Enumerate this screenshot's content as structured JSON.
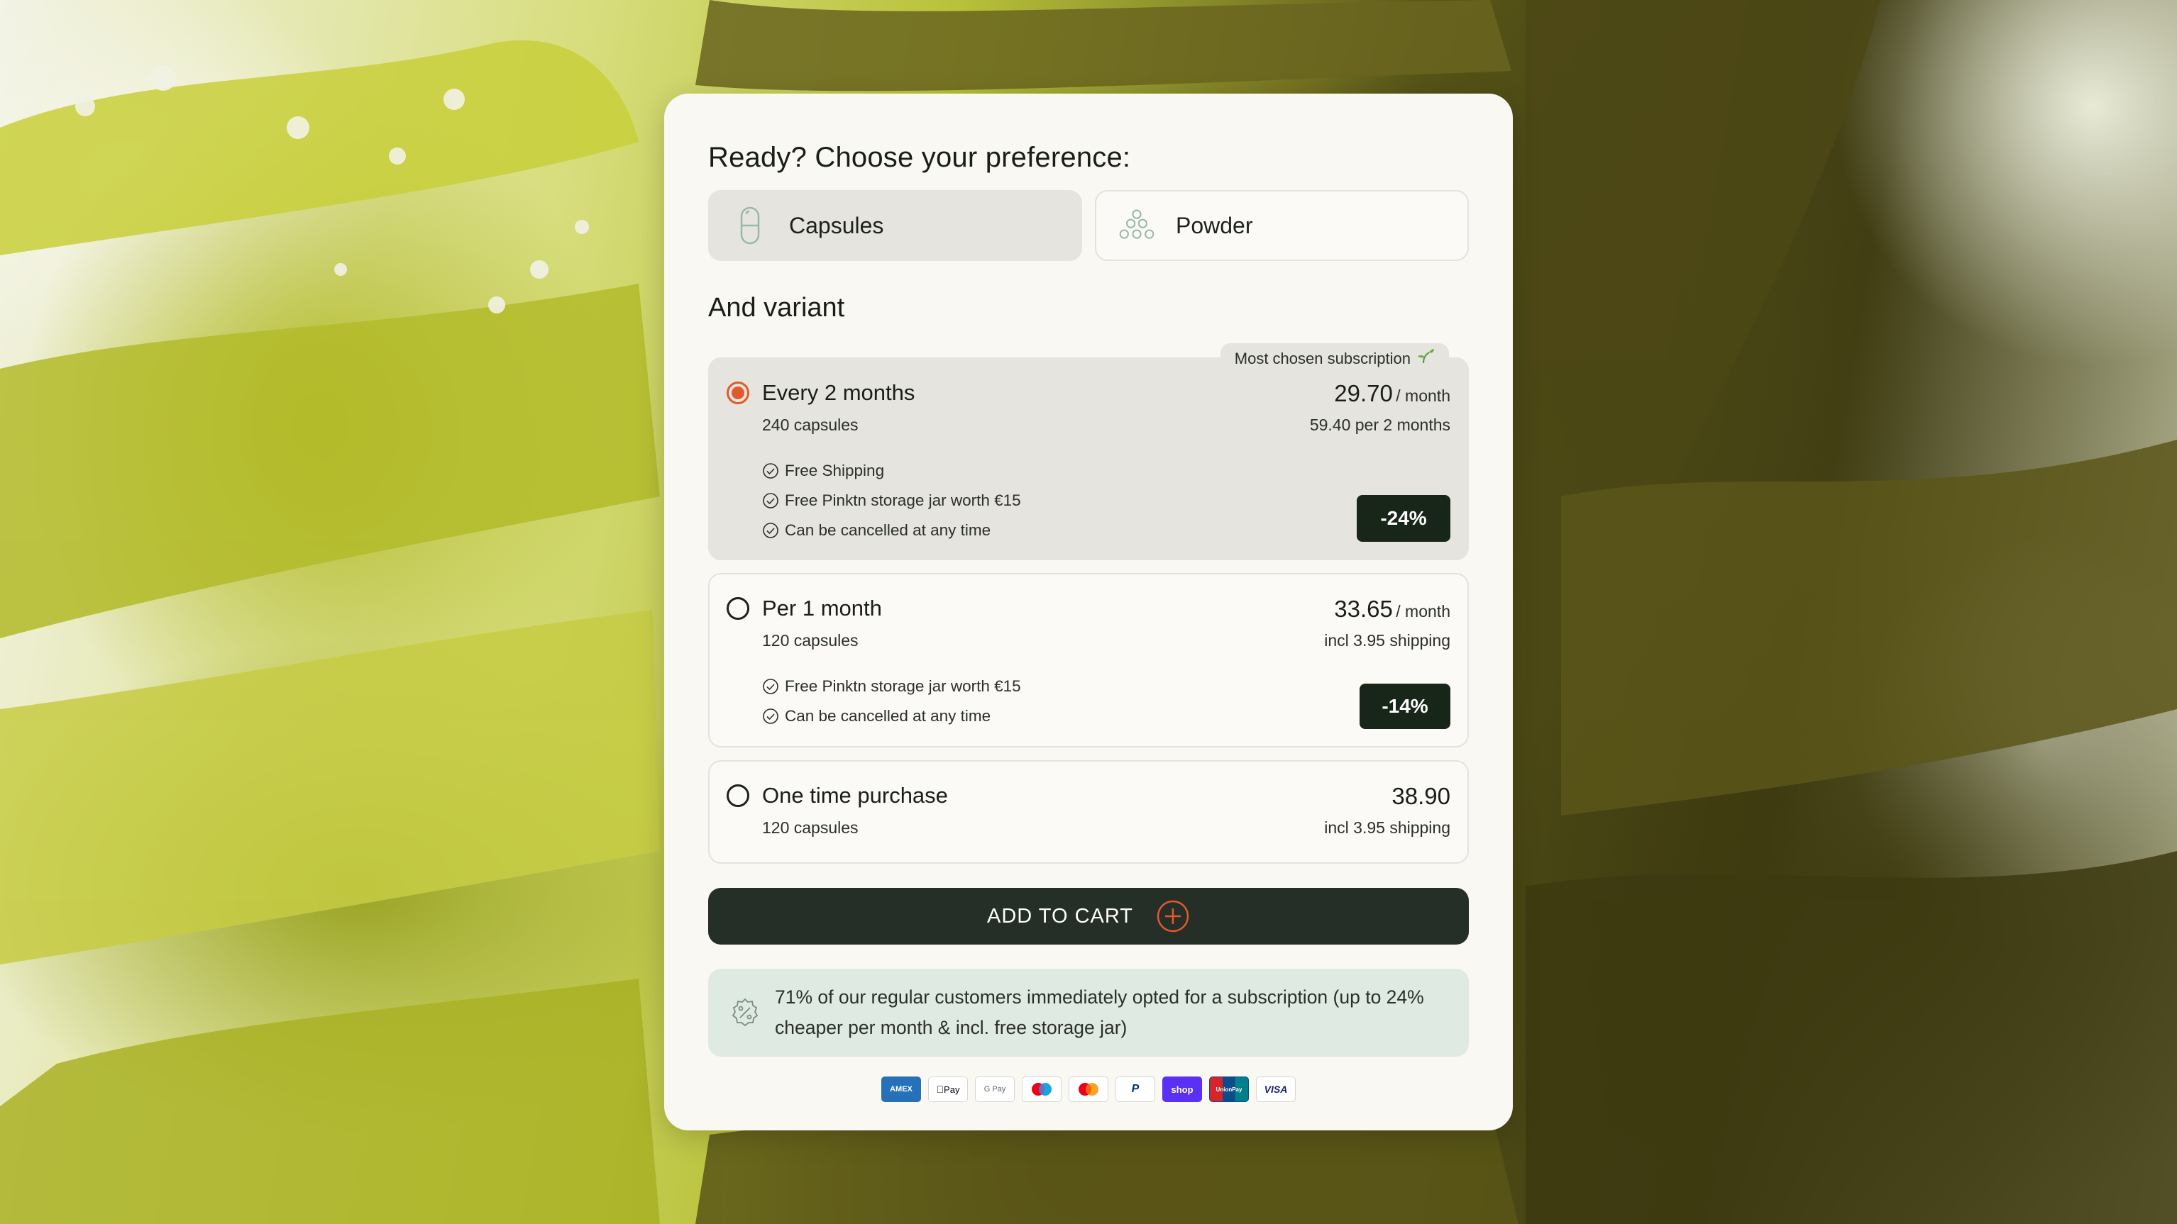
{
  "preference": {
    "title": "Ready? Choose your preference:",
    "options": [
      {
        "label": "Capsules",
        "icon": "capsule-icon",
        "selected": true
      },
      {
        "label": "Powder",
        "icon": "powder-icon",
        "selected": false
      }
    ]
  },
  "variant": {
    "title": "And variant",
    "most_chosen_tag": "Most chosen subscription",
    "options": [
      {
        "name": "Every 2 months",
        "quantity": "240 capsules",
        "price": "29.70",
        "price_unit": "/ month",
        "price_sub": "59.40 per 2 months",
        "features": [
          "Free Shipping",
          "Free Pinktn storage jar worth €15",
          "Can be cancelled at any time"
        ],
        "discount": "-24%",
        "selected": true
      },
      {
        "name": "Per 1 month",
        "quantity": "120 capsules",
        "price": "33.65",
        "price_unit": "/ month",
        "price_sub": "incl 3.95 shipping",
        "features": [
          "Free Pinktn storage jar worth €15",
          "Can be cancelled at any time"
        ],
        "discount": "-14%",
        "selected": false
      },
      {
        "name": "One time purchase",
        "quantity": "120 capsules",
        "price": "38.90",
        "price_sub": "incl 3.95 shipping",
        "selected": false
      }
    ]
  },
  "cart": {
    "label": "ADD TO CART"
  },
  "info": {
    "text": "71% of our regular customers immediately opted for a subscription (up to 24% cheaper per month & incl. free storage jar)"
  },
  "payments": [
    {
      "name": "American Express",
      "short": "AMEX",
      "color": "#2671b9"
    },
    {
      "name": "Apple Pay",
      "short": "Pay",
      "color": "#000000"
    },
    {
      "name": "Google Pay",
      "short": "G Pay",
      "color": "#5f6368"
    },
    {
      "name": "Maestro",
      "short": "",
      "color": "#0099df"
    },
    {
      "name": "Mastercard",
      "short": "",
      "color": "#eb001b"
    },
    {
      "name": "PayPal",
      "short": "P",
      "color": "#003087"
    },
    {
      "name": "Shop Pay",
      "short": "shop",
      "color": "#5a31f4"
    },
    {
      "name": "UnionPay",
      "short": "UnionPay",
      "color": "#d6252a"
    },
    {
      "name": "Visa",
      "short": "VISA",
      "color": "#1a1f71"
    }
  ],
  "colors": {
    "accent_radio": "#e25a2c",
    "dark_green": "#252e27",
    "badge": "#182519",
    "info_bg": "#deeae2"
  }
}
